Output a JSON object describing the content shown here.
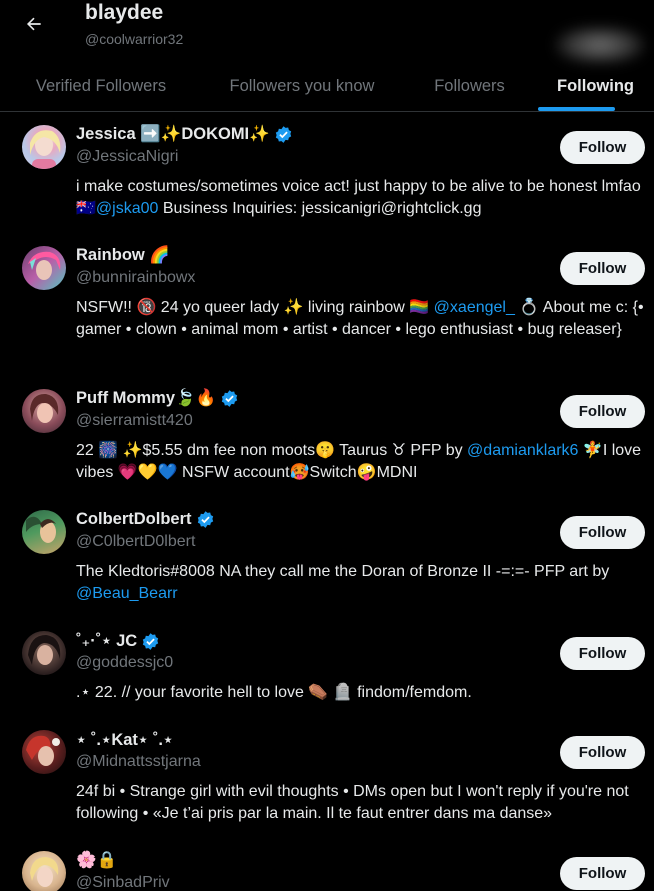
{
  "header": {
    "title": "blaydee",
    "handle": "@coolwarrior32"
  },
  "tabs": [
    {
      "label": "Verified Followers"
    },
    {
      "label": "Followers you know"
    },
    {
      "label": "Followers"
    },
    {
      "label": "Following"
    }
  ],
  "colors": {
    "accent": "#1d9bf0",
    "background": "#000000",
    "text_primary": "#e7e9ea",
    "text_secondary": "#71767b",
    "button_bg": "#eff3f4"
  },
  "follow_label": "Follow",
  "users": [
    {
      "name": "Jessica ➡️✨DOKOMI✨",
      "verified": true,
      "handle": "@JessicaNigri",
      "bio_1": "i make costumes/sometimes voice act! just happy to be alive to be honest lmfao 🇦🇺",
      "bio_mention_1": "@jska00",
      "bio_2": " Business Inquiries: jessicanigri@rightclick.gg"
    },
    {
      "name": "Rainbow 🌈",
      "verified": false,
      "handle": "@bunnirainbowx",
      "bio_1": "NSFW!! 🔞 24 yo queer lady ✨ living rainbow 🏳️‍🌈 ",
      "bio_mention_1": "@xaengel_",
      "bio_2": " 💍 About me c: {• gamer • clown • animal mom • artist • dancer • lego enthusiast • bug releaser}"
    },
    {
      "name": "Puff Mommy🍃🔥",
      "verified": true,
      "handle": "@sierramistt420",
      "bio_1": "22 🎆 ✨$5.55 dm fee non moots🤫 Taurus ♉ PFP by ",
      "bio_mention_1": "@damianklark6",
      "bio_2": " 🧚I love vibes 💗💛💙 NSFW account🥵Switch🤪MDNI"
    },
    {
      "name": "ColbertDolbert",
      "verified": true,
      "handle": "@C0lbertD0lbert",
      "bio_1": "The Kledtoris#8008 NA they call me the Doran of Bronze II -=:=- PFP art by ",
      "bio_mention_1": "@Beau_Bearr",
      "bio_2": ""
    },
    {
      "name": "˚₊·˚⋆ JC",
      "verified": true,
      "handle": "@goddessjc0",
      "bio_1": ".⋆ 22. // your favorite hell to love ⚰️ 🪦 findom/femdom.",
      "bio_mention_1": "",
      "bio_2": ""
    },
    {
      "name": "⋆ ˚.⋆Kat⋆ ˚.⋆",
      "verified": false,
      "handle": "@Midnattsstjarna",
      "bio_1": "24f bi • Strange girl with evil thoughts • DMs open but I won't reply if you're not following • «Je t’ai pris par la main. Il te faut entrer dans ma danse»",
      "bio_mention_1": "",
      "bio_2": ""
    },
    {
      "name": "🌸🔒",
      "verified": false,
      "handle": "@SinbadPriv",
      "bio_1": "",
      "bio_mention_1": "",
      "bio_2": ""
    }
  ]
}
